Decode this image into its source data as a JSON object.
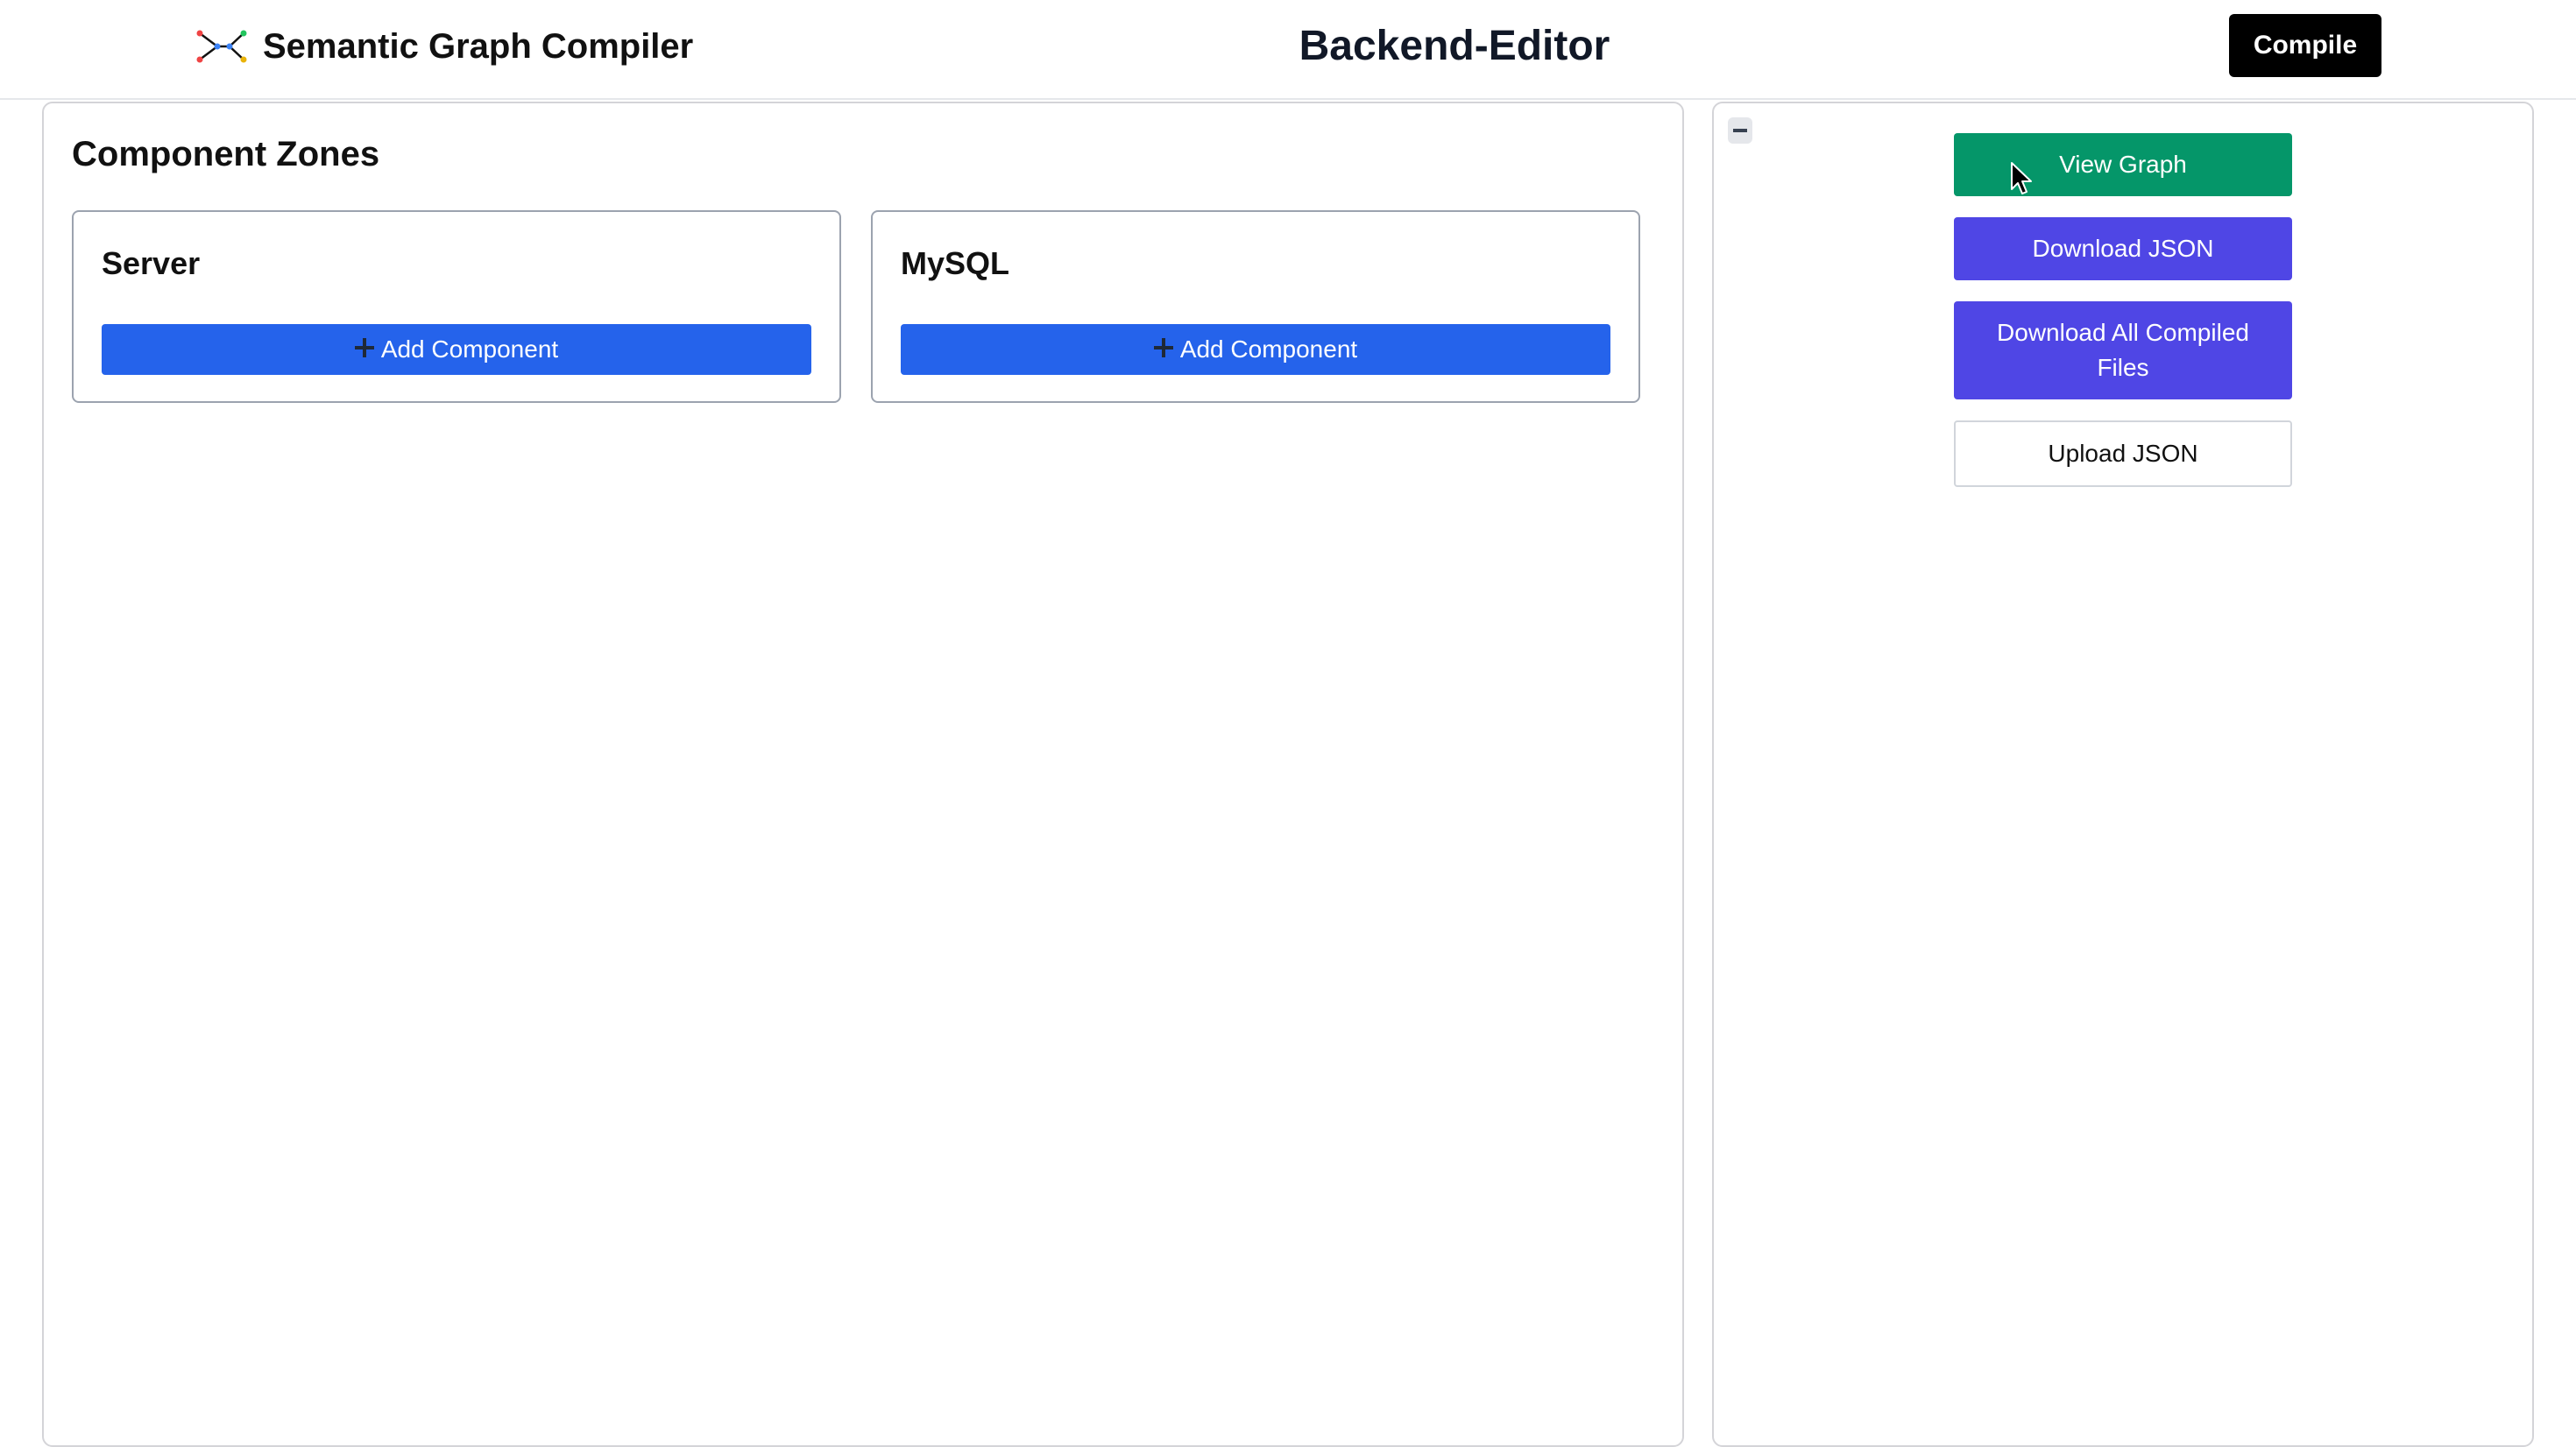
{
  "header": {
    "app_title": "Semantic Graph Compiler",
    "logo_icon": "graph-logo-icon",
    "page_title": "Backend-Editor",
    "compile_label": "Compile"
  },
  "main": {
    "heading": "Component Zones",
    "zones": [
      {
        "title": "Server",
        "add_label": "Add Component",
        "add_icon": "plus-icon"
      },
      {
        "title": "MySQL",
        "add_label": "Add Component",
        "add_icon": "plus-icon"
      }
    ]
  },
  "side": {
    "collapse_icon": "minus-icon",
    "buttons": {
      "view_graph": "View Graph",
      "download_json": "Download JSON",
      "download_all": "Download All Compiled Files",
      "upload_json": "Upload JSON"
    }
  },
  "colors": {
    "compile": "#000000",
    "add_component": "#2563eb",
    "view_graph": "#059669",
    "download": "#4f46e5",
    "upload": "#ffffff"
  }
}
